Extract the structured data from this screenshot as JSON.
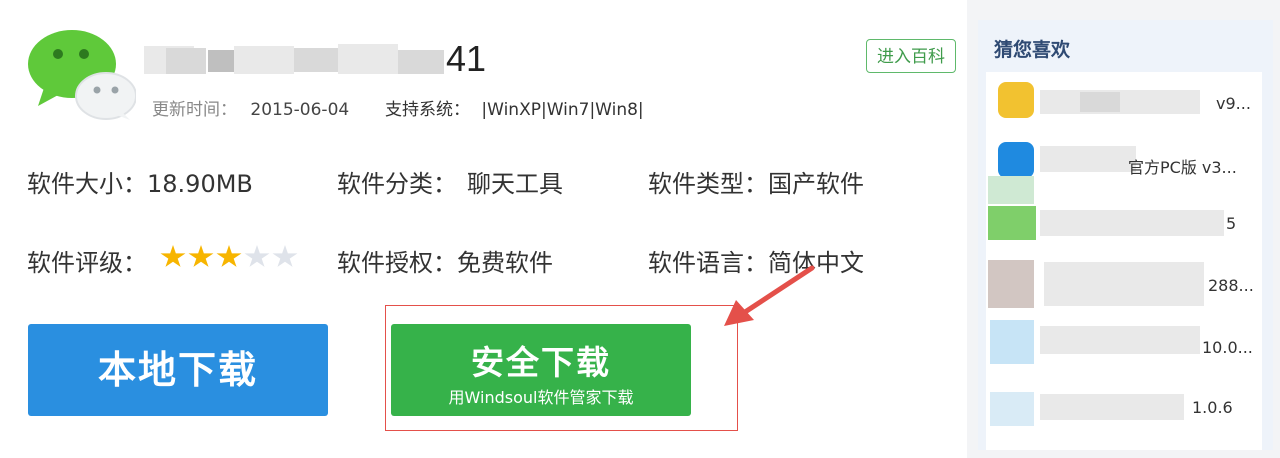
{
  "header": {
    "title_suffix": "41",
    "update_label": "更新时间：",
    "update_value": "2015-06-04",
    "os_label": "支持系统：",
    "os_value": "|WinXP|Win7|Win8|",
    "baike_button": "进入百科"
  },
  "fields": {
    "size_label": "软件大小：",
    "size_value": "18.90MB",
    "category_label": "软件分类：",
    "category_value": "聊天工具",
    "type_label": "软件类型：",
    "type_value": "国产软件",
    "rating_label": "软件评级：",
    "rating_value": 3,
    "rating_max": 5,
    "license_label": "软件授权：",
    "license_value": "免费软件",
    "language_label": "软件语言：",
    "language_value": "简体中文"
  },
  "buttons": {
    "local_download": "本地下载",
    "safe_download": "安全下载",
    "safe_download_sub": "用Windsoul软件管家下载"
  },
  "sidebar": {
    "title": "猜您喜欢",
    "items": [
      {
        "visible_text": "v9..."
      },
      {
        "visible_text": "官方PC版 v3..."
      },
      {
        "visible_text": "5"
      },
      {
        "visible_text": "288..."
      },
      {
        "visible_text": "10.0..."
      },
      {
        "visible_text": "1.0.6"
      }
    ]
  },
  "colors": {
    "local_button": "#2a8fe0",
    "safe_button": "#36b24a",
    "highlight_red": "#e4504a",
    "star_on": "#f7b500"
  }
}
